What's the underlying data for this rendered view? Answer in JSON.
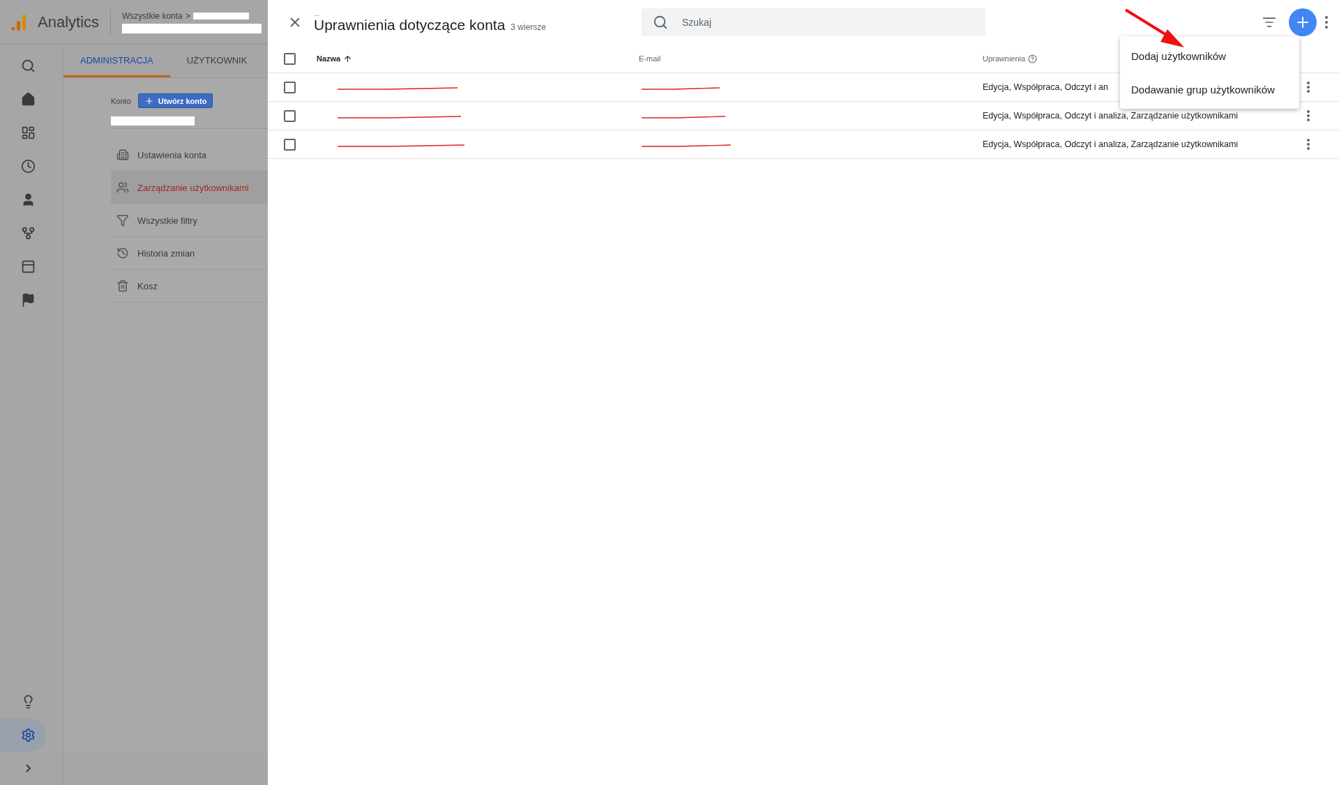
{
  "app": {
    "name": "Analytics",
    "breadcrumb": "Wszystkie konta",
    "separator": ">"
  },
  "rail": [
    {
      "selected": false
    },
    {
      "selected": false
    },
    {
      "selected": false
    },
    {
      "selected": false
    },
    {
      "selected": false
    },
    {
      "selected": false
    },
    {
      "selected": false
    },
    {
      "selected": false
    }
  ],
  "rail_bottom": [
    {
      "selected": false
    },
    {
      "selected": true
    },
    {
      "selected": false
    }
  ],
  "tabs": [
    {
      "label": "ADMINISTRACJA",
      "selected": true
    },
    {
      "label": "UŻYTKOWNIK",
      "selected": false
    }
  ],
  "account": {
    "label": "Konto",
    "create_button": "Utwórz konto"
  },
  "admin_menu": [
    {
      "label": "Ustawienia konta",
      "selected": false
    },
    {
      "label": "Zarządzanie użytkownikami",
      "selected": true
    },
    {
      "label": "Wszystkie filtry",
      "selected": false
    },
    {
      "label": "Historia zmian",
      "selected": false
    },
    {
      "label": "Kosz",
      "selected": false
    }
  ],
  "panel": {
    "breadcrumb_dots": "...",
    "title": "Uprawnienia dotyczące konta",
    "count": "3 wiersze",
    "search": {
      "placeholder": "Szukaj"
    }
  },
  "table": {
    "select_all_checked": false,
    "columns": [
      {
        "label": "Nazwa",
        "sorted": true
      },
      {
        "label": "E-mail",
        "sorted": false
      },
      {
        "label": "Uprawnienia",
        "sorted": false
      }
    ],
    "rows": [
      {
        "permissions": "Edycja, Współpraca, Odczyt i an",
        "checked": false
      },
      {
        "permissions": "Edycja, Współpraca, Odczyt i analiza, Zarządzanie użytkownikami",
        "checked": false
      },
      {
        "permissions": "Edycja, Współpraca, Odczyt i analiza, Zarządzanie użytkownikami",
        "checked": false
      }
    ]
  },
  "add_menu": [
    "Dodaj użytkowników",
    "Dodawanie grup użytkowników"
  ]
}
